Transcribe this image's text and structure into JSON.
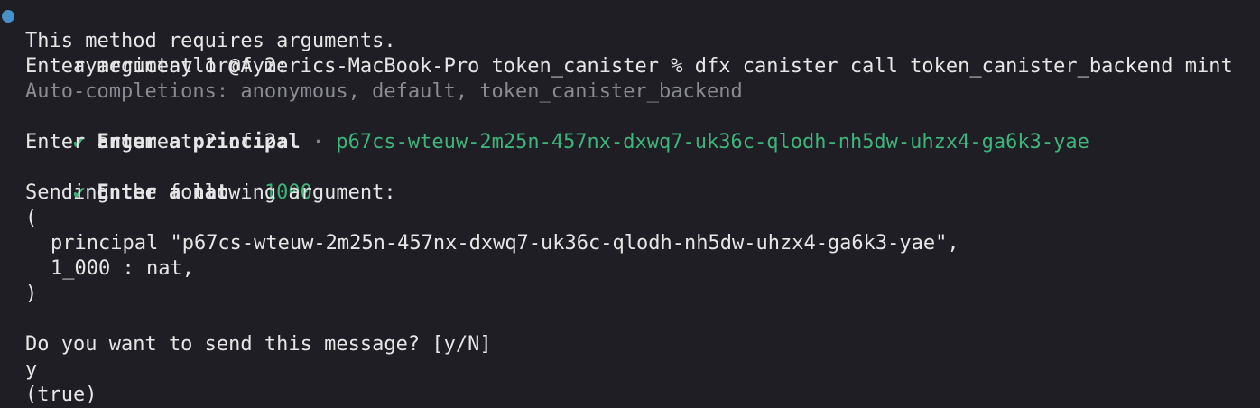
{
  "terminal": {
    "prompt": "aymerictaylor@Aymerics-MacBook-Pro token_canister % dfx canister call token_canister_backend mint",
    "requires_args": "This method requires arguments.",
    "enter_arg1": "Enter argument 1 of 2:",
    "autocomplete": "Auto-completions: anonymous, default, token_canister_backend",
    "principal_check": "✔",
    "principal_label": "Enter a principal",
    "principal_sep": " · ",
    "principal_value": "p67cs-wteuw-2m25n-457nx-dxwq7-uk36c-qlodh-nh5dw-uhzx4-ga6k3-yae",
    "enter_arg2": "Enter argument 2 of 2:",
    "nat_check": "✔",
    "nat_label": "Enter a nat",
    "nat_sep": " · ",
    "nat_value": "1000",
    "sending": "Sending the following argument:",
    "open_paren": "(",
    "arg_principal": "principal \"p67cs-wteuw-2m25n-457nx-dxwq7-uk36c-qlodh-nh5dw-uhzx4-ga6k3-yae\",",
    "arg_nat": "1_000 : nat,",
    "close_paren": ")",
    "confirm_question": "Do you want to send this message? [y/N]",
    "user_answer": "y",
    "result": "(true)"
  },
  "colors": {
    "background": "#1e1e24",
    "text": "#e6e6e6",
    "dim": "#8b8b92",
    "accent_green": "#3fb47a",
    "prompt_dot": "#4a90c8"
  }
}
